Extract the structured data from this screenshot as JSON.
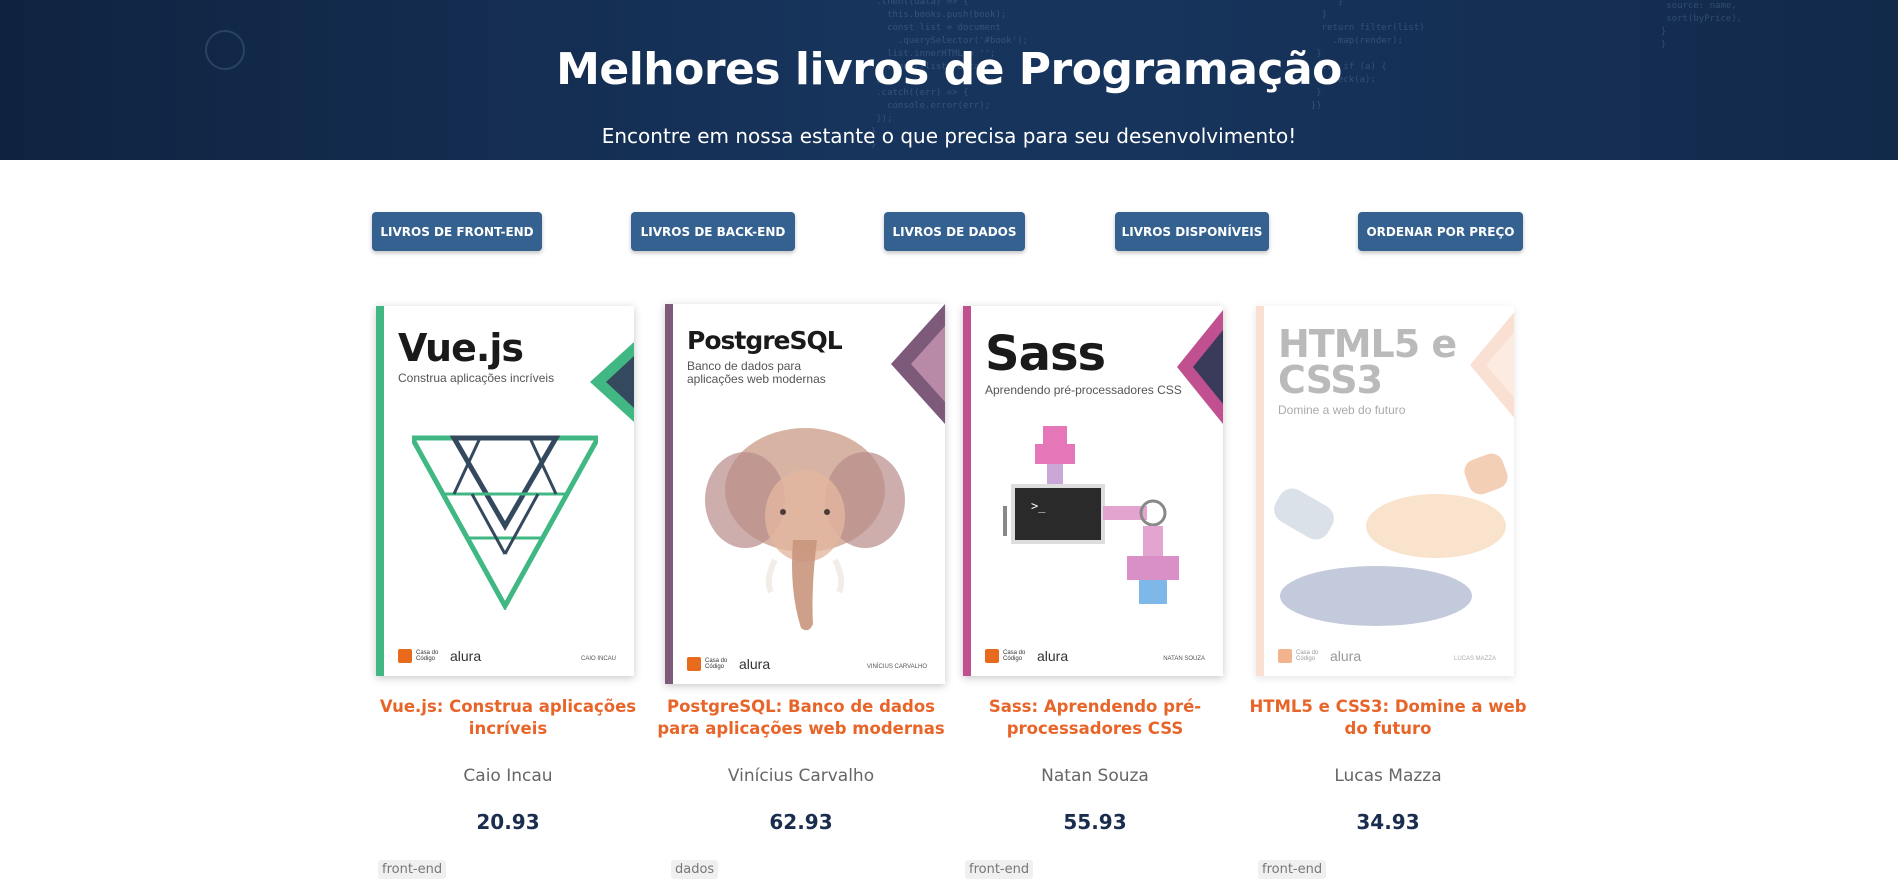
{
  "header": {
    "title": "Melhores livros de Programação",
    "subtitle": "Encontre em nossa estante o que precisa para seu desenvolvimento!"
  },
  "filters": [
    {
      "label": "LIVROS DE FRONT-END"
    },
    {
      "label": "LIVROS DE BACK-END"
    },
    {
      "label": "LIVROS DE DADOS"
    },
    {
      "label": "LIVROS DISPONÍVEIS"
    },
    {
      "label": "ORDENAR POR PREÇO"
    }
  ],
  "books": [
    {
      "cover_title": "Vue.js",
      "cover_subtitle": "Construa aplicações incríveis",
      "cover_author": "CAIO INCAU",
      "title": "Vue.js: Construa aplicações incríveis",
      "author": "Caio Incau",
      "price": "20.93",
      "category": "front-end",
      "accent": "#41b883",
      "accent2": "#35495e"
    },
    {
      "cover_title": "PostgreSQL",
      "cover_subtitle": "Banco de dados para aplicações web modernas",
      "cover_author": "VINÍCIUS CARVALHO",
      "title": "PostgreSQL: Banco de dados para aplicações web modernas",
      "author": "Vinícius Carvalho",
      "price": "62.93",
      "category": "dados",
      "accent": "#7d5a7a",
      "accent2": "#b98aa8"
    },
    {
      "cover_title": "Sass",
      "cover_subtitle": "Aprendendo pré-processadores CSS",
      "cover_author": "NATAN SOUZA",
      "title": "Sass: Aprendendo pré-processadores CSS",
      "author": "Natan Souza",
      "price": "55.93",
      "category": "front-end",
      "accent": "#c0508f",
      "accent2": "#3a3a5a"
    },
    {
      "cover_title": "HTML5 e CSS3",
      "cover_subtitle": "Domine a web do futuro",
      "cover_author": "LUCAS MAZZA",
      "title": "HTML5 e CSS3: Domine a web do futuro",
      "author": "Lucas Mazza",
      "price": "34.93",
      "category": "front-end",
      "accent": "#f4c2a8",
      "accent2": "#f9d9c4"
    }
  ],
  "publisher": {
    "line1": "Casa do Código",
    "brand": "alura"
  },
  "colors": {
    "banner": "#17345c",
    "button": "#34618f",
    "book_title": "#e8652a",
    "price": "#1b2d4f"
  }
}
